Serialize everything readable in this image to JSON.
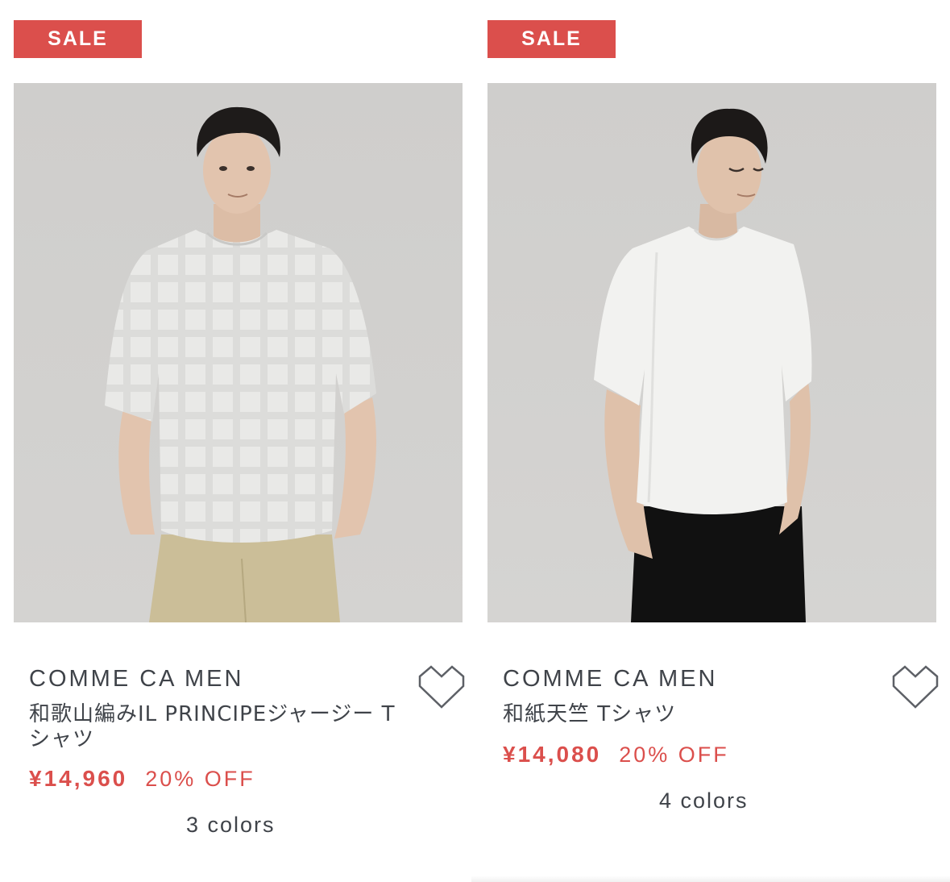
{
  "products": [
    {
      "badge": "SALE",
      "brand": "COMME CA MEN",
      "name": "和歌山編みIL PRINCIPEジャージー Tシャツ",
      "price": "¥14,960",
      "discount": "20% OFF",
      "colors": "3  colors"
    },
    {
      "badge": "SALE",
      "brand": "COMME CA MEN",
      "name": "和紙天竺 Tシャツ",
      "price": "¥14,080",
      "discount": "20% OFF",
      "colors": "4  colors"
    }
  ],
  "icons": {
    "favorite": "heart-outline-icon"
  },
  "theme": {
    "sale_red": "#db4f4c",
    "text_dark": "#3f4349",
    "photo_background": "#d1d0ce"
  }
}
